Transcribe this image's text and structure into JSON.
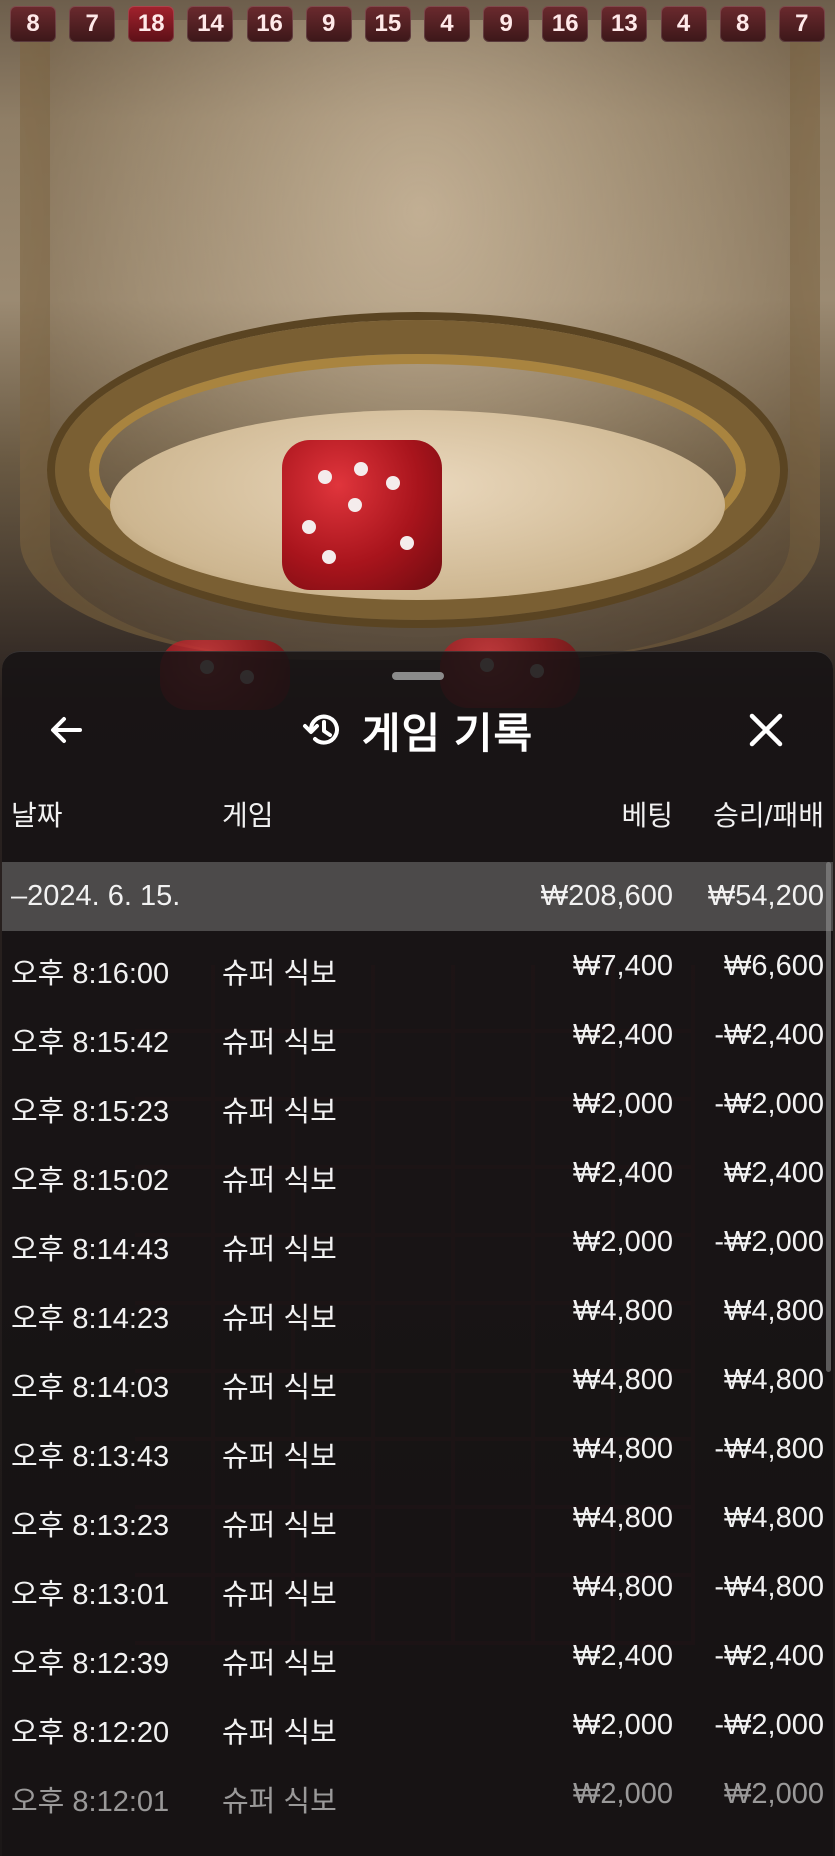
{
  "history": [
    "8",
    "7",
    "18",
    "14",
    "16",
    "9",
    "15",
    "4",
    "9",
    "16",
    "13",
    "4",
    "8",
    "7"
  ],
  "panel": {
    "title": "게임 기록",
    "icons": {
      "back": "arrow-left-icon",
      "history": "history-icon",
      "close": "close-icon"
    }
  },
  "columns": {
    "date": "날짜",
    "game": "게임",
    "bet": "베팅",
    "win_loss": "승리/패배"
  },
  "date_group": {
    "date": "–2024. 6. 15.",
    "bet": "₩208,600",
    "win_loss": "₩54,200"
  },
  "rows": [
    {
      "time": "오후 8:16:00",
      "game": "슈퍼 식보",
      "bet": "₩7,400",
      "win_loss": "₩6,600"
    },
    {
      "time": "오후 8:15:42",
      "game": "슈퍼 식보",
      "bet": "₩2,400",
      "win_loss": "-₩2,400"
    },
    {
      "time": "오후 8:15:23",
      "game": "슈퍼 식보",
      "bet": "₩2,000",
      "win_loss": "-₩2,000"
    },
    {
      "time": "오후 8:15:02",
      "game": "슈퍼 식보",
      "bet": "₩2,400",
      "win_loss": "₩2,400"
    },
    {
      "time": "오후 8:14:43",
      "game": "슈퍼 식보",
      "bet": "₩2,000",
      "win_loss": "-₩2,000"
    },
    {
      "time": "오후 8:14:23",
      "game": "슈퍼 식보",
      "bet": "₩4,800",
      "win_loss": "₩4,800"
    },
    {
      "time": "오후 8:14:03",
      "game": "슈퍼 식보",
      "bet": "₩4,800",
      "win_loss": "₩4,800"
    },
    {
      "time": "오후 8:13:43",
      "game": "슈퍼 식보",
      "bet": "₩4,800",
      "win_loss": "-₩4,800"
    },
    {
      "time": "오후 8:13:23",
      "game": "슈퍼 식보",
      "bet": "₩4,800",
      "win_loss": "₩4,800"
    },
    {
      "time": "오후 8:13:01",
      "game": "슈퍼 식보",
      "bet": "₩4,800",
      "win_loss": "-₩4,800"
    },
    {
      "time": "오후 8:12:39",
      "game": "슈퍼 식보",
      "bet": "₩2,400",
      "win_loss": "-₩2,400"
    },
    {
      "time": "오후 8:12:20",
      "game": "슈퍼 식보",
      "bet": "₩2,000",
      "win_loss": "-₩2,000"
    },
    {
      "time": "오후 8:12:01",
      "game": "슈퍼 식보",
      "bet": "₩2,000",
      "win_loss": "₩2,000"
    }
  ]
}
